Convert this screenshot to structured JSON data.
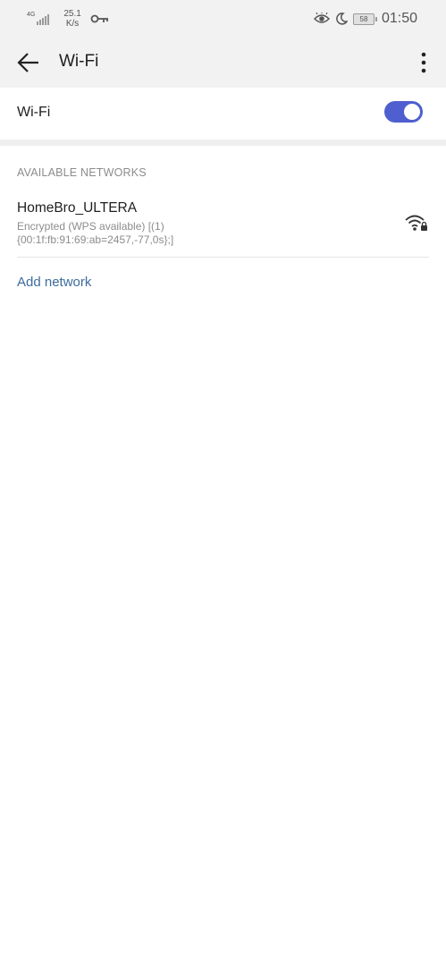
{
  "status_bar": {
    "network_type": "4G",
    "speed_value": "25.1",
    "speed_unit": "K/s",
    "battery_level": "58",
    "time": "01:50",
    "icons": [
      "signal-icon",
      "vpn-key-icon",
      "eye-comfort-icon",
      "do-not-disturb-moon-icon",
      "battery-icon"
    ]
  },
  "app_bar": {
    "title": "Wi-Fi",
    "back_icon": "arrow-back-icon",
    "more_icon": "more-vertical-icon"
  },
  "wifi_toggle": {
    "label": "Wi-Fi",
    "enabled": true,
    "accent_color": "#4f5fcf"
  },
  "available_networks": {
    "header": "AVAILABLE NETWORKS",
    "networks": [
      {
        "name": "HomeBro_ULTERA",
        "detail_line1": "Encrypted (WPS available)   [(1)",
        "detail_line2": "{00:1f:fb:91:69:ab=2457,-77,0s};]",
        "icon": "wifi-locked-icon"
      }
    ],
    "add_network_label": "Add network",
    "link_color": "#3c6c9c"
  }
}
